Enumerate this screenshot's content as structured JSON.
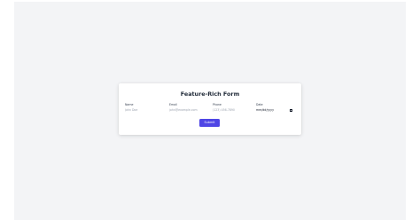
{
  "form": {
    "title": "Feature-Rich Form",
    "fields": [
      {
        "label": "Name",
        "placeholder": "John Doe"
      },
      {
        "label": "Email",
        "placeholder": "john@example.com"
      },
      {
        "label": "Phone",
        "placeholder": "(123) 456-7890"
      },
      {
        "label": "Date",
        "value": "mm/dd/yyyy"
      }
    ],
    "submit_label": "Submit"
  },
  "colors": {
    "accent": "#4f46e5",
    "page_background": "#f3f4f6"
  },
  "icons": {
    "date_picker": "calendar-icon"
  }
}
